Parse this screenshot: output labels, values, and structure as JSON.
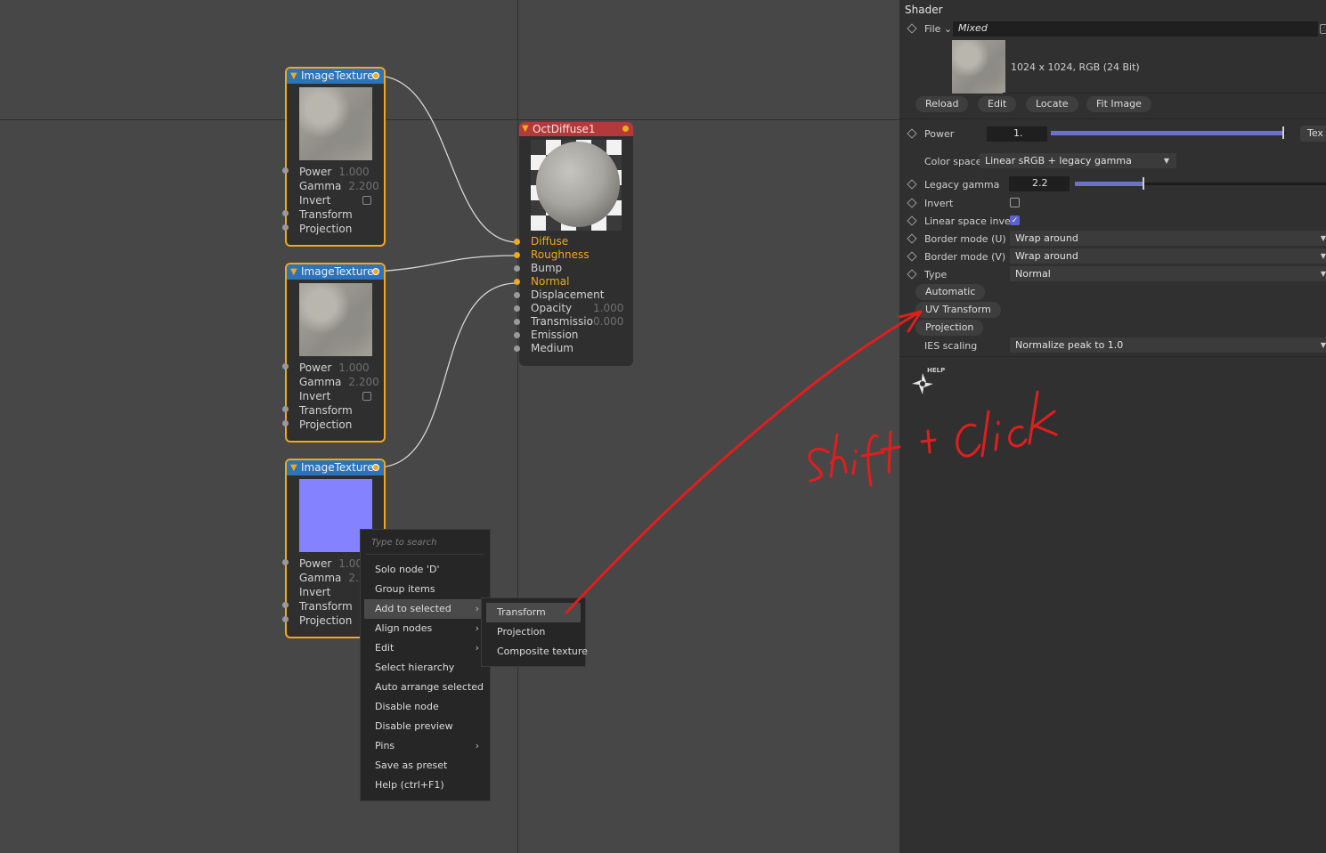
{
  "nodes": {
    "tex1": {
      "title": "ImageTexture",
      "rows": [
        {
          "label": "Power",
          "value": "1.000"
        },
        {
          "label": "Gamma",
          "value": "2.200"
        },
        {
          "label": "Invert",
          "value": ""
        },
        {
          "label": "Transform",
          "value": ""
        },
        {
          "label": "Projection",
          "value": ""
        }
      ]
    },
    "tex2": {
      "title": "ImageTexture",
      "rows": [
        {
          "label": "Power",
          "value": "1.000"
        },
        {
          "label": "Gamma",
          "value": "2.200"
        },
        {
          "label": "Invert",
          "value": ""
        },
        {
          "label": "Transform",
          "value": ""
        },
        {
          "label": "Projection",
          "value": ""
        }
      ]
    },
    "tex3": {
      "title": "ImageTexture",
      "rows": [
        {
          "label": "Power",
          "value": "1.00"
        },
        {
          "label": "Gamma",
          "value": "2.20"
        },
        {
          "label": "Invert",
          "value": ""
        },
        {
          "label": "Transform",
          "value": ""
        },
        {
          "label": "Projection",
          "value": ""
        }
      ]
    },
    "diffuse": {
      "title": "OctDiffuse1",
      "rows": [
        {
          "label": "Diffuse",
          "value": ""
        },
        {
          "label": "Roughness",
          "value": ""
        },
        {
          "label": "Bump",
          "value": ""
        },
        {
          "label": "Normal",
          "value": ""
        },
        {
          "label": "Displacement",
          "value": ""
        },
        {
          "label": "Opacity",
          "value": "1.000"
        },
        {
          "label": "Transmissio",
          "value": "0.000"
        },
        {
          "label": "Emission",
          "value": ""
        },
        {
          "label": "Medium",
          "value": ""
        }
      ]
    }
  },
  "context_menu": {
    "search_placeholder": "Type to search",
    "items": [
      {
        "label": "Solo node   'D'",
        "submenu": false
      },
      {
        "label": "Group items",
        "submenu": false
      },
      {
        "label": "Add to selected",
        "submenu": true
      },
      {
        "label": "Align nodes",
        "submenu": true
      },
      {
        "label": "Edit",
        "submenu": true
      },
      {
        "label": "Select hierarchy",
        "submenu": false
      },
      {
        "label": "Auto arrange selected",
        "submenu": false
      },
      {
        "label": "Disable node",
        "submenu": false
      },
      {
        "label": "Disable preview",
        "submenu": false
      },
      {
        "label": "Pins",
        "submenu": true
      },
      {
        "label": "Save as preset",
        "submenu": false
      },
      {
        "label": "Help (ctrl+F1)",
        "submenu": false
      }
    ],
    "highlighted": "Add to selected"
  },
  "submenu": {
    "items": [
      "Transform",
      "Projection",
      "Composite texture"
    ],
    "highlighted": "Transform"
  },
  "panel": {
    "title": "Shader",
    "file_label": "File",
    "file_value": "Mixed",
    "image_info": "1024 x 1024, RGB (24 Bit)",
    "buttons": [
      "Reload",
      "Edit",
      "Locate",
      "Fit Image"
    ],
    "power_label": "Power",
    "power_value": "1.",
    "power_fraction": 1.0,
    "tex_button": "Tex",
    "color_space_label": "Color space",
    "color_space_value": "Linear sRGB + legacy gamma",
    "legacy_gamma_label": "Legacy gamma",
    "legacy_gamma_value": "2.2",
    "invert_label": "Invert",
    "invert_checked": false,
    "linear_invert_label": "Linear space invert",
    "linear_invert_checked": true,
    "border_u_label": "Border mode (U)",
    "border_u_value": "Wrap around",
    "border_v_label": "Border mode (V)",
    "border_v_value": "Wrap around",
    "type_label": "Type",
    "type_value": "Normal",
    "pill_buttons": [
      "Automatic",
      "UV Transform",
      "Projection"
    ],
    "ies_label": "IES scaling",
    "ies_value": "Normalize peak to 1.0",
    "help_label": "HELP"
  },
  "colors": {
    "accent_orange": "#f0a81e",
    "node_blue": "#2d73b8",
    "node_red": "#b23a3a",
    "annotation_red": "#e01e1e",
    "slider_blue": "#6b73c9"
  }
}
